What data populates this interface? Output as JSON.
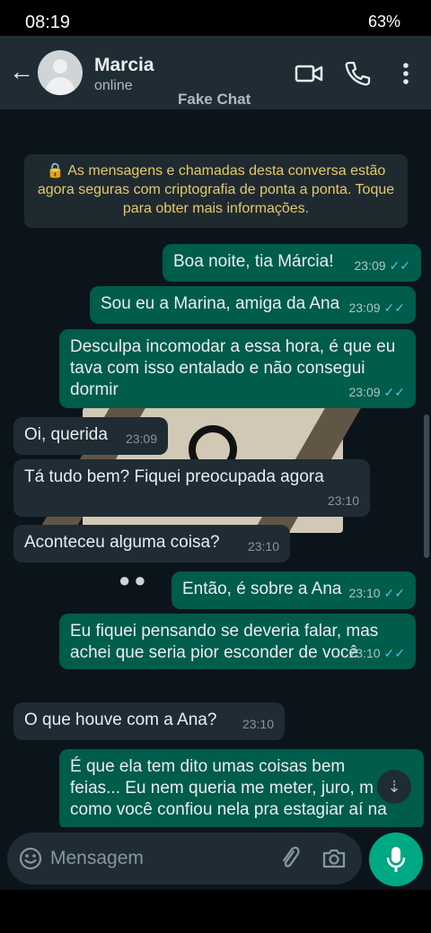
{
  "status_bar": {
    "time": "08:19",
    "battery": "63%"
  },
  "header": {
    "name": "Marcia",
    "status": "online",
    "watermark": "Fake Chat"
  },
  "encryption_notice": "🔒 As mensagens e chamadas desta conversa estão agora seguras com criptografia de ponta a ponta. Toque para obter mais informações.",
  "messages": [
    {
      "dir": "out",
      "text": "Boa noite, tia Márcia!",
      "time": "23:09"
    },
    {
      "dir": "out",
      "text": "Sou eu a Marina, amiga da Ana",
      "time": "23:09"
    },
    {
      "dir": "out",
      "text": "Desculpa incomodar a essa hora, é que eu tava com isso entalado e não consegui dormir",
      "time": "23:09"
    },
    {
      "dir": "in",
      "text": "Oi, querida",
      "time": "23:09"
    },
    {
      "dir": "in",
      "text": "Tá tudo bem? Fiquei preocupada agora",
      "time": "23:10"
    },
    {
      "dir": "in",
      "text": "Aconteceu alguma coisa?",
      "time": "23:10"
    },
    {
      "dir": "out",
      "text": "Então, é sobre a Ana",
      "time": "23:10"
    },
    {
      "dir": "out",
      "text": "Eu fiquei pensando se deveria falar, mas achei que seria pior esconder de você",
      "time": "23:10"
    },
    {
      "dir": "in",
      "text": "O que houve com a Ana?",
      "time": "23:10"
    },
    {
      "dir": "out",
      "text": "É que ela tem dito umas coisas bem feias... Eu nem queria me meter, juro, m como você confiou nela pra estagiar aí na",
      "time": ""
    }
  ],
  "composer": {
    "placeholder": "Mensagem"
  },
  "icons": {
    "back": "arrow-left-icon",
    "video": "video-camera-icon",
    "call": "phone-icon",
    "menu": "more-vertical-icon",
    "emoji": "emoji-icon",
    "attach": "paperclip-icon",
    "camera": "camera-icon",
    "mic": "microphone-icon",
    "scroll": "chevron-double-down-icon"
  },
  "colors": {
    "header_bg": "#1f2c34",
    "chat_bg": "#0b141a",
    "outgoing": "#005c4b",
    "incoming": "#1f2c34",
    "accent": "#00a884",
    "notice_text": "#e7c86a",
    "read_ticks": "#53bdeb"
  }
}
